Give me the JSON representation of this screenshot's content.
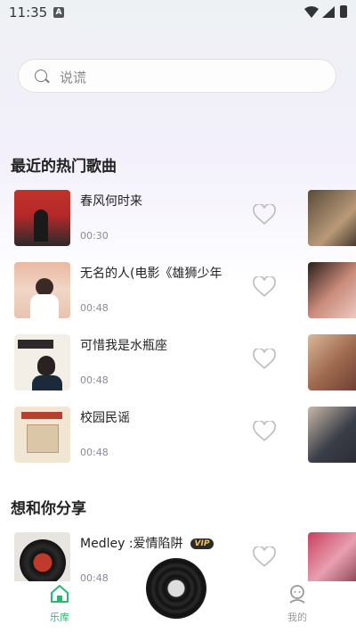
{
  "status_bar": {
    "time": "11:35",
    "notification_icon": "A"
  },
  "search": {
    "placeholder": "说谎"
  },
  "sections": {
    "hot": "最近的热门歌曲",
    "share": "想和你分享"
  },
  "songs": [
    {
      "title": "春风何时来",
      "duration": "00:30"
    },
    {
      "title": "无名的人(电影《雄狮少年",
      "duration": "00:48"
    },
    {
      "title": "可惜我是水瓶座",
      "duration": "00:48"
    },
    {
      "title": "校园民谣",
      "duration": "00:48"
    }
  ],
  "share_songs": [
    {
      "title": "Medley :爱情陷阱",
      "duration": "00:48",
      "badge": "VIP"
    }
  ],
  "tabs": {
    "library": "乐库",
    "mine": "我的"
  },
  "colors": {
    "accent": "#2bb673",
    "text": "#222222",
    "muted": "#8a8a96"
  }
}
